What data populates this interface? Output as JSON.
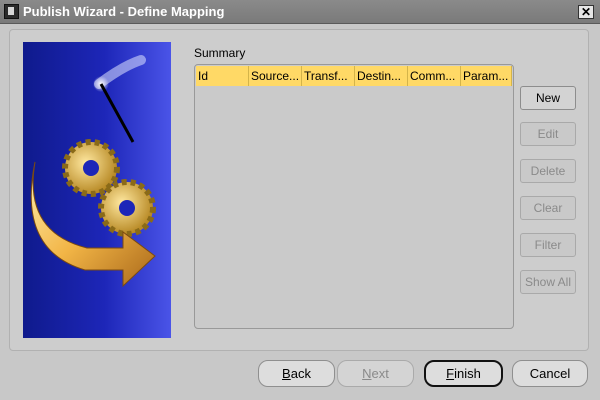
{
  "window": {
    "title": "Publish Wizard - Define Mapping",
    "close_glyph": "✕"
  },
  "summary": {
    "label": "Summary",
    "columns": [
      "Id",
      "Source...",
      "Transf...",
      "Destin...",
      "Comm...",
      "Param..."
    ]
  },
  "side_buttons": [
    {
      "label": "New",
      "enabled": true
    },
    {
      "label": "Edit",
      "enabled": false
    },
    {
      "label": "Delete",
      "enabled": false
    },
    {
      "label": "Clear",
      "enabled": false
    },
    {
      "label": "Filter",
      "enabled": false
    },
    {
      "label": "Show All",
      "enabled": false
    }
  ],
  "footer": {
    "back": {
      "mnemonic": "B",
      "rest": "ack"
    },
    "next": {
      "mnemonic": "N",
      "rest": "ext"
    },
    "finish": {
      "mnemonic": "F",
      "rest": "inish"
    },
    "cancel": "Cancel"
  },
  "colors": {
    "header_yellow": "#ffd966",
    "graphic_blue": "#1d26b8"
  },
  "icons": {
    "app": "app-icon",
    "close": "close-icon",
    "gears": "gears-icon",
    "arrow": "arrow-icon",
    "wand": "wand-icon"
  }
}
